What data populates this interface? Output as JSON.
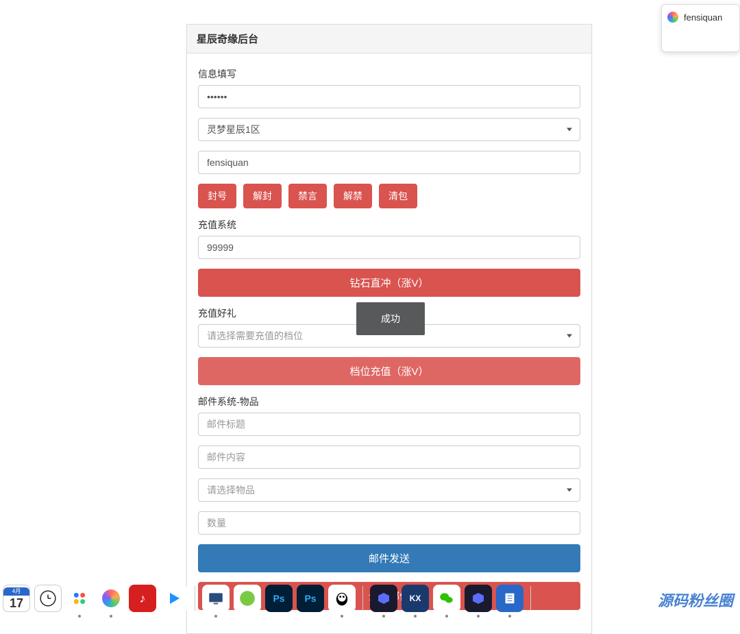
{
  "panel": {
    "title": "星辰奇缘后台"
  },
  "info": {
    "label": "信息填写",
    "password_value": "••••••",
    "server_selected": "灵梦星辰1区",
    "username_value": "fensiquan"
  },
  "actions": {
    "ban": "封号",
    "unban": "解封",
    "mute": "禁言",
    "unmute": "解禁",
    "clearbag": "清包"
  },
  "recharge": {
    "label": "充值系统",
    "amount_value": "99999",
    "diamond_btn": "钻石直冲（涨V）"
  },
  "gift": {
    "label": "充值好礼",
    "tier_placeholder": "请选择需要充值的档位",
    "tier_btn": "档位充值（涨V）"
  },
  "toast": {
    "text": "成功"
  },
  "mail": {
    "label": "邮件系统-物品",
    "title_placeholder": "邮件标题",
    "content_placeholder": "邮件内容",
    "item_placeholder": "请选择物品",
    "qty_placeholder": "数量",
    "send_btn": "邮件发送",
    "all_btn": "全服邮件"
  },
  "popup": {
    "text": "fensiquan"
  },
  "taskbar": {
    "calendar_month": "4月",
    "calendar_day": "17"
  },
  "watermark": "源码粉丝圈"
}
